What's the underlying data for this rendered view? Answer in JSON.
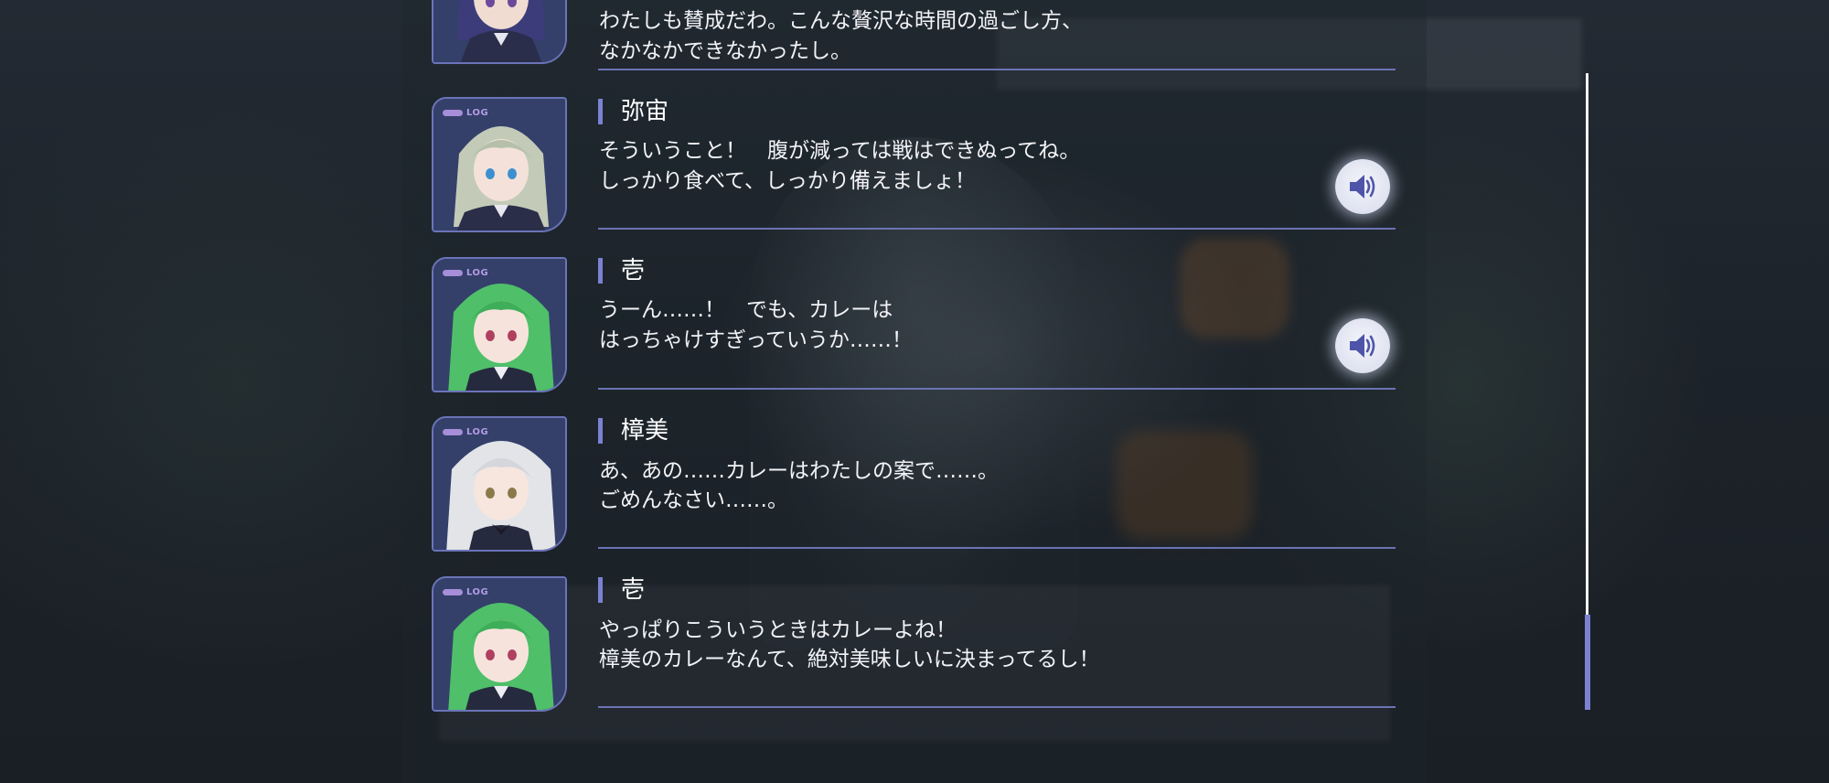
{
  "log_tag": "LOG",
  "entries": [
    {
      "name": "",
      "line1": "わたしも賛成だわ。こんな贅沢な時間の過ごし方、",
      "line2": "なかなかできなかったし。",
      "voice": false,
      "portrait": "navy-hair-character"
    },
    {
      "name": "弥宙",
      "line1": "そういうこと！　腹が減っては戦はできぬってね。",
      "line2": "しっかり食べて、しっかり備えましょ！",
      "voice": true,
      "portrait": "silver-green-hair-character"
    },
    {
      "name": "壱",
      "line1": "うーん……！　でも、カレーは",
      "line2": "はっちゃけすぎっていうか……！",
      "voice": true,
      "portrait": "green-hair-character"
    },
    {
      "name": "樟美",
      "line1": "あ、あの……カレーはわたしの案で……。",
      "line2": "ごめんなさい……。",
      "voice": false,
      "portrait": "white-hair-character"
    },
    {
      "name": "壱",
      "line1": "やっぱりこういうときはカレーよね！",
      "line2": "樟美のカレーなんて、絶対美味しいに決まってるし！",
      "voice": false,
      "portrait": "green-hair-character"
    }
  ],
  "scroll": {
    "position": 0.87
  },
  "colors": {
    "accent": "#7b82d2",
    "divider": "#6b73b4",
    "text": "#f2f3f6",
    "log_tag": "#b39be4"
  }
}
